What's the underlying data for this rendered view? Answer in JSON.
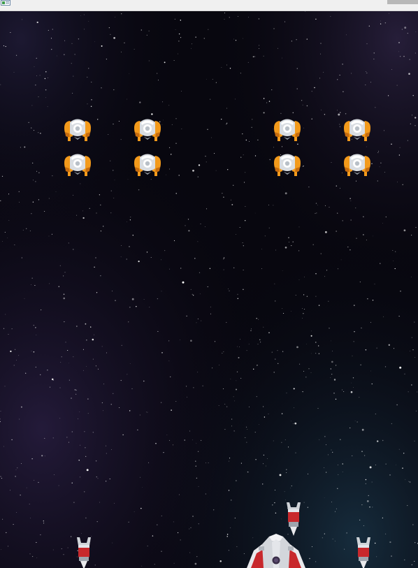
{
  "window": {
    "title": "",
    "icon": "java-app-icon"
  },
  "scene": {
    "background": "deep-space-starfield",
    "colors": {
      "space_dark": "#07060f",
      "nebula_purple": "#3a2a5c",
      "nebula_teal": "#1c3c50",
      "alien_body": "#f39a1b",
      "alien_shell": "#d9dde2",
      "player_red": "#c8282c",
      "player_white": "#e9e9ec"
    }
  },
  "enemies": {
    "formation": {
      "rows": 2,
      "columns": 4,
      "type": "orange-alien-ship"
    }
  },
  "player": {
    "type": "red-white-fighter-ship",
    "projectile": "red-missile",
    "escorts": 2
  }
}
